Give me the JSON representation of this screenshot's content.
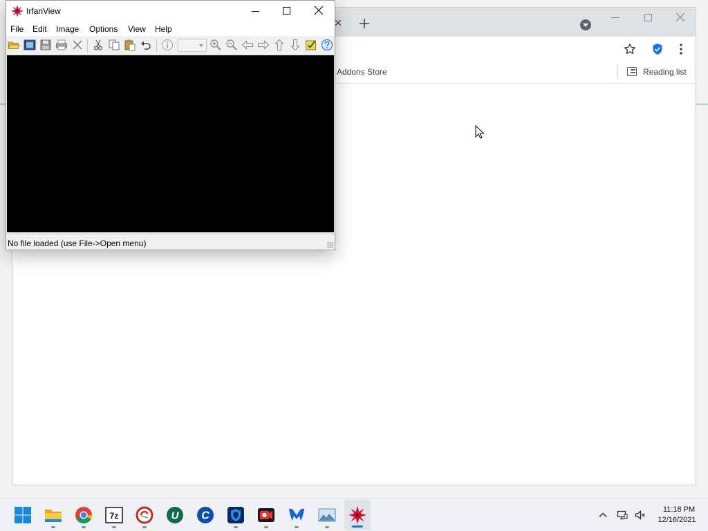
{
  "irfanview": {
    "title": "IrfanView",
    "menu": [
      "File",
      "Edit",
      "Image",
      "Options",
      "View",
      "Help"
    ],
    "status_text": "No file loaded (use File->Open menu)",
    "toolbar_icons": [
      "open-folder-icon",
      "slideshow-icon",
      "save-icon",
      "print-icon",
      "delete-icon",
      "cut-icon",
      "copy-icon",
      "paste-icon",
      "undo-icon",
      "info-icon",
      "zoom-combo",
      "zoom-in-icon",
      "zoom-out-icon",
      "previous-icon",
      "next-icon",
      "first-icon",
      "last-icon",
      "thumbnails-icon",
      "help-icon"
    ]
  },
  "browser": {
    "tab_close": "✕",
    "new_tab": "+",
    "bookmarks": {
      "addons_store": "Addons Store",
      "reading_list": "Reading list"
    }
  },
  "taskbar": {
    "apps": [
      "start",
      "file-explorer",
      "chrome",
      "7-zip",
      "ccleaner",
      "uplay",
      "ccleaner-browser",
      "vpn",
      "screen-recorder",
      "malwarebytes",
      "image-viewer",
      "irfanview"
    ],
    "active_app": "irfanview",
    "time": "11:18 PM",
    "date": "12/16/2021"
  },
  "colors": {
    "accent": "#1a73c4",
    "canvas": "#000000",
    "irfan_red": "#c8102e"
  }
}
